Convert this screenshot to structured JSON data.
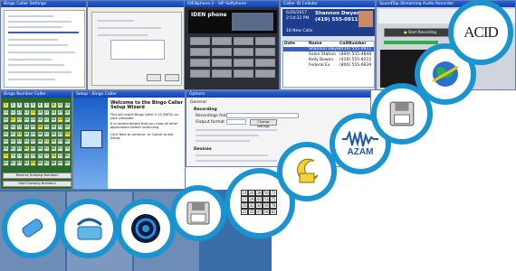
{
  "windows": {
    "settings": {
      "title": "Bingo Caller Settings"
    },
    "wizard": {
      "title": "Setup - Bingo Caller",
      "heading": "Welcome to the Bingo Caller Setup Wizard",
      "body": "This will install Bingo Caller 2.10 (BETA) on your computer.",
      "body2": "It is recommended that you close all other applications before continuing.",
      "body3": "Click Next to continue, or Cancel to exit Setup."
    },
    "board": {
      "title": "Bingo Number Caller",
      "footer1": "Reverse Drawing Numbers",
      "footer2": "Start Drawing Numbers"
    },
    "phone": {
      "brand": "IDEN phone",
      "title": "IDENphone 2 - SIP Softphone"
    },
    "callerid": {
      "title": "Caller ID Cellular",
      "date": "6/26/2017",
      "time": "2:14:32 PM",
      "caller_name": "Shannon Dwyer",
      "caller_number": "(419) 555-0911",
      "new_calls": "18 New Calls",
      "col_date": "Date",
      "col_name": "Name",
      "col_number": "CallNumber",
      "rows": [
        {
          "name": "Shannon Dwyer",
          "number": "(419) 555-0911"
        },
        {
          "name": "Salon Station",
          "number": "(800) 555-4848"
        },
        {
          "name": "Kelly Bowen",
          "number": "(419) 555-8215"
        },
        {
          "name": "Federal Ex",
          "number": "(800) 555-6839"
        }
      ]
    },
    "recorder": {
      "title": "SoundTap Streaming Audio Recorder",
      "start": "Start Recording"
    },
    "options": {
      "title": "Options",
      "tab": "General",
      "section1": "Recording",
      "lbl_folder": "Recordings folder",
      "lbl_format": "Output format",
      "btn_change": "Change settings",
      "section2": "Devices"
    }
  },
  "board_numbers": [
    "1",
    "2",
    "3",
    "4",
    "5",
    "6",
    "7",
    "8",
    "9",
    "10",
    "11",
    "12",
    "13",
    "14",
    "15",
    "16",
    "17",
    "18",
    "19",
    "20",
    "21",
    "22",
    "23",
    "24",
    "25",
    "26",
    "27",
    "28",
    "29",
    "30",
    "31",
    "32",
    "33",
    "34",
    "35",
    "36",
    "37",
    "38",
    "39",
    "40",
    "41",
    "42",
    "43",
    "44",
    "45",
    "46",
    "47",
    "48",
    "49",
    "50",
    "51",
    "52",
    "53",
    "54",
    "55",
    "56",
    "57",
    "58",
    "59",
    "60",
    "61",
    "62",
    "63",
    "64",
    "65",
    "66",
    "67",
    "68",
    "69",
    "70",
    "71",
    "72",
    "73",
    "74",
    "75",
    "76",
    "77",
    "78",
    "79",
    "80",
    "81",
    "82",
    "83",
    "84",
    "85",
    "86",
    "87",
    "88",
    "89",
    "90"
  ],
  "ticket": [
    "14",
    "26",
    "38",
    "50",
    "72",
    "17",
    "29",
    "41",
    "53",
    "75",
    "20",
    "32",
    "44",
    "56",
    "78",
    "23",
    "35",
    "47",
    "59",
    "81"
  ],
  "icons": {
    "acid": {
      "label": "ACID"
    },
    "azam": {
      "label": "AZAM"
    }
  },
  "colors": {
    "ring": "#1a93d1",
    "titlebar": "#1a4fc4"
  }
}
